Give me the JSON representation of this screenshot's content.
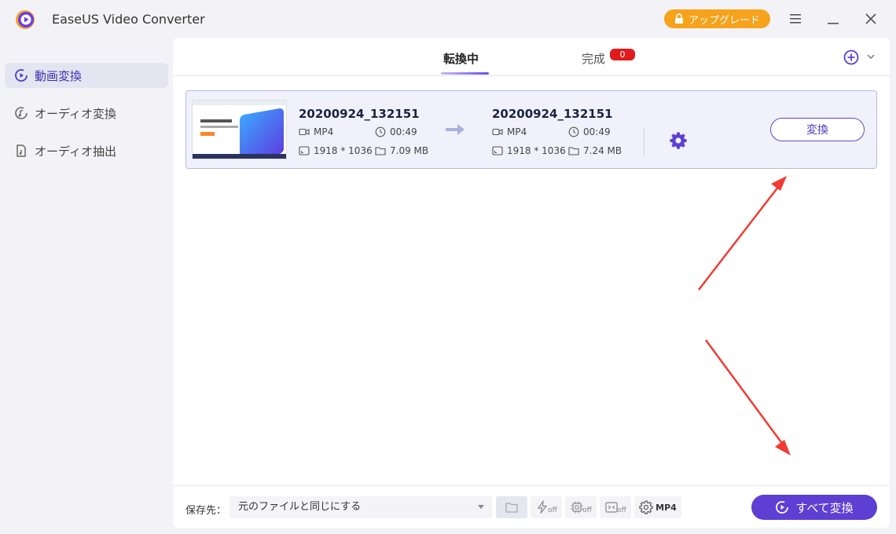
{
  "app": {
    "title": "EaseUS Video Converter",
    "upgrade_label": "アップグレード"
  },
  "sidebar": {
    "items": [
      {
        "label": "動画変換",
        "active": true,
        "icon": "video-convert-icon"
      },
      {
        "label": "オーディオ変換",
        "active": false,
        "icon": "audio-convert-icon"
      },
      {
        "label": "オーディオ抽出",
        "active": false,
        "icon": "audio-extract-icon"
      }
    ]
  },
  "tabs": {
    "converting": "転換中",
    "completed": "完成",
    "completed_count": "0"
  },
  "file": {
    "source": {
      "name": "20200924_132151",
      "format": "MP4",
      "duration": "00:49",
      "resolution": "1918 * 1036",
      "size": "7.09 MB"
    },
    "output": {
      "name": "20200924_132151",
      "format": "MP4",
      "duration": "00:49",
      "resolution": "1918 * 1036",
      "size": "7.24 MB"
    },
    "convert_label": "変換"
  },
  "bottom": {
    "save_label": "保存先：",
    "save_value": "元のファイルと同じにする",
    "off_label": "off",
    "format_label": "MP4",
    "convert_all_label": "すべて変換"
  },
  "colors": {
    "accent": "#5d3fd3",
    "upgrade": "#f7a21b",
    "badge": "#e01b1b",
    "annotation": "#f03c32"
  }
}
